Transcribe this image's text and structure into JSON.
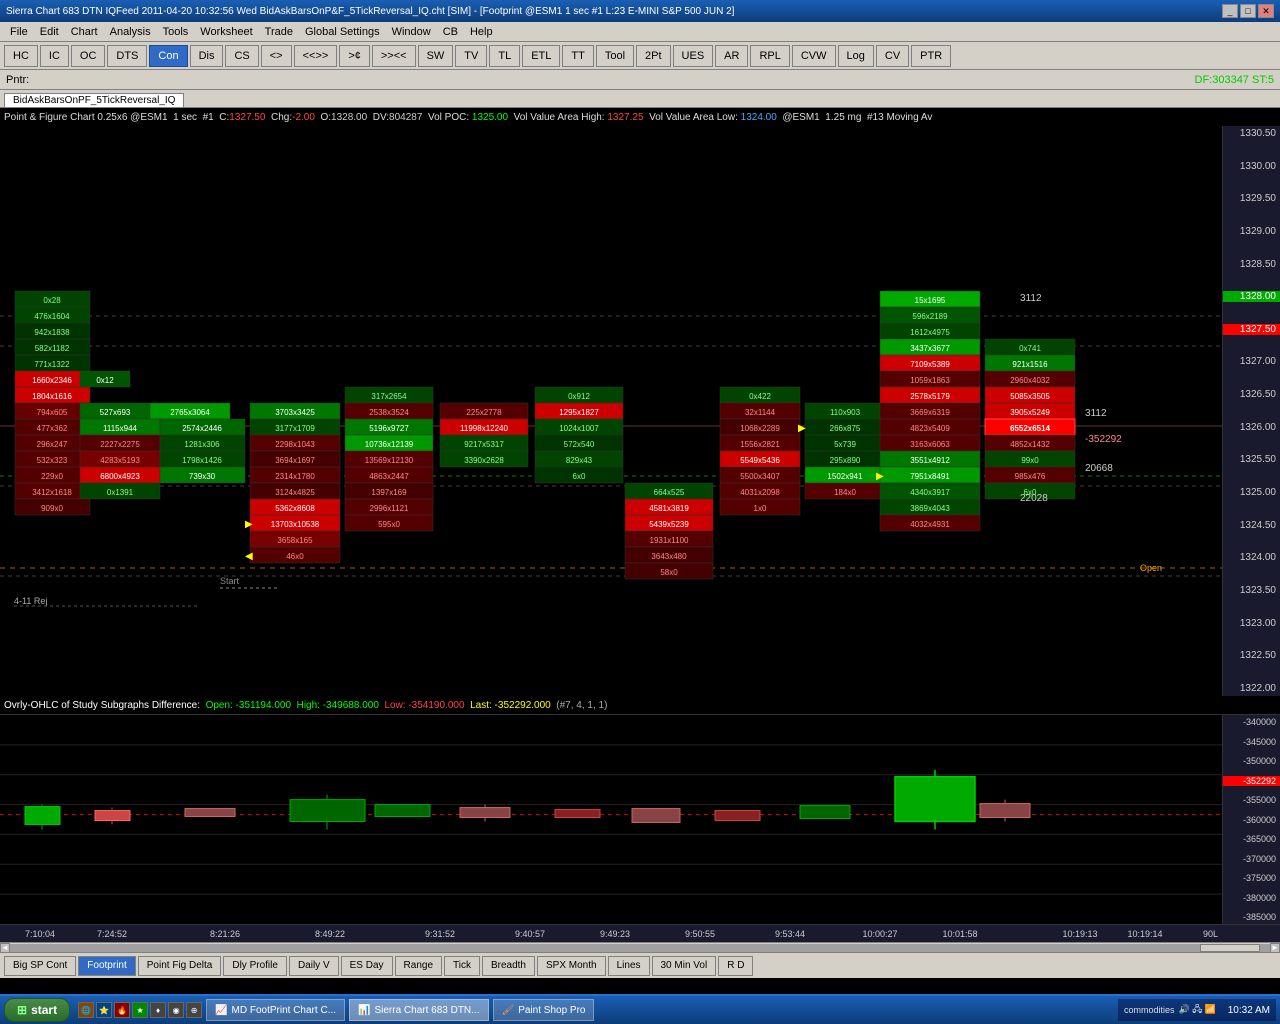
{
  "titleBar": {
    "title": "Sierra Chart 683 DTN IQFeed 2011-04-20  10:32:56  Wed  BidAskBarsOnP&F_5TickReversal_IQ.cht [SIM] - [Footprint @ESM1  1 sec  #1  L:23  E-MINI S&P 500 JUN 2]",
    "winButtons": [
      "_",
      "□",
      "✕"
    ]
  },
  "menuBar": {
    "items": [
      "File",
      "Edit",
      "Chart",
      "Analysis",
      "Tools",
      "Worksheet",
      "Trade",
      "Global Settings",
      "Window",
      "CB",
      "Help"
    ]
  },
  "toolbar": {
    "buttons": [
      "HC",
      "IC",
      "OC",
      "DTS",
      "Con",
      "Dis",
      "CS",
      "<>",
      "<<>>",
      ">¢",
      ">><<",
      "SW",
      "TV",
      "TL",
      "ETL",
      "TT",
      "Tool",
      "2Pt",
      "UES",
      "AR",
      "RPL",
      "CVW",
      "Log",
      "CV",
      "PTR"
    ],
    "activeBtn": "Con"
  },
  "statusBar": {
    "pntr": "Pntr:",
    "dfSt": "DF:303347  ST:5"
  },
  "chartTab": {
    "label": "BidAskBarsOnPF_5TickReversal_IQ"
  },
  "infoBar": {
    "text": "Point & Figure Chart 0.25x6 @ESM1  1 sec  #1  C:1327.50  Chg:-2.00  O:1328.00  DV:804287  Vol POC: 1325.00  Vol Value Area High: 1327.25  Vol Value Area Low: 1324.00  @ESM1  1.25 mg  #13 Moving Av"
  },
  "priceScale": {
    "labels": [
      "1330.50",
      "1330.00",
      "1329.50",
      "1329.00",
      "1328.50",
      "1328.00",
      "1327.50",
      "1327.00",
      "1326.50",
      "1326.00",
      "1325.50",
      "1325.00",
      "1324.50",
      "1324.00",
      "1323.50",
      "1323.00",
      "1322.50",
      "1322.00"
    ],
    "highlighted": "1327.50",
    "greenHighlighted": "1328.00"
  },
  "chartAnnotations": {
    "start": "Start",
    "open": "Open",
    "rej411": "4-11 Rej",
    "val3112a": "3112",
    "val3112b": "3112",
    "valNeg352292": "-352292",
    "val20668": "20668",
    "val22028": "22028"
  },
  "subInfoBar": {
    "text": "Ovrly-OHLC of Study Subgraphs Difference:  Open: -351194.000  High: -349688.000  Low: -354190.000  Last: -352292.000  (#7, 4, 1, 1)",
    "openColor": "#00ff00",
    "highColor": "#00ff00",
    "lowColor": "#ff4444",
    "lastColor": "#ffff00"
  },
  "subPriceScale": {
    "labels": [
      "-340000",
      "-345000",
      "-350000",
      "-355000",
      "-360000",
      "-365000",
      "-370000",
      "-375000",
      "-380000",
      "-385000"
    ],
    "highlighted": "-352292"
  },
  "timeAxis": {
    "labels": [
      "7:10:04",
      "7:24:52",
      "8:21:26",
      "8:49:22",
      "9:31:52",
      "9:40:57",
      "9:49:23",
      "9:50:55",
      "9:53:44",
      "10:00:27",
      "10:01:58",
      "10:19:13",
      "10:19:14"
    ],
    "scrollNote": "90L"
  },
  "bottomTabs": {
    "tabs": [
      "Big SP Cont",
      "Footprint",
      "Point Fig Delta",
      "Dly Profile",
      "Daily V",
      "ES Day",
      "Range",
      "Tick",
      "Breadth",
      "SPX Month",
      "Lines",
      "30 Min Vol",
      "R D"
    ],
    "activeTab": "Footprint"
  },
  "taskbar": {
    "startLabel": "start",
    "items": [
      "MD FootPrint Chart C...",
      "Sierra Chart 683 DTN...",
      "Paint Shop Pro"
    ],
    "time": "10:32 AM",
    "commodities": "commodities"
  },
  "footprintCells": [
    {
      "col": 0,
      "row": 0,
      "text": "0x28",
      "type": "dark-green"
    },
    {
      "col": 0,
      "row": 1,
      "text": "476x1604",
      "type": "dark-green"
    },
    {
      "col": 0,
      "row": 2,
      "text": "942x1838",
      "type": "dark-green"
    },
    {
      "col": 0,
      "row": 3,
      "text": "582x1182",
      "type": "dark-green"
    },
    {
      "col": 0,
      "row": 4,
      "text": "771x1322",
      "type": "dark-green"
    },
    {
      "col": 0,
      "row": 5,
      "text": "1660x2346",
      "type": "bright-red"
    },
    {
      "col": 0,
      "row": 6,
      "text": "1804x1616",
      "type": "bright-red"
    },
    {
      "col": 0,
      "row": 7,
      "text": "794x605",
      "type": "dark-red"
    },
    {
      "col": 0,
      "row": 8,
      "text": "477x362",
      "type": "dark-red"
    },
    {
      "col": 0,
      "row": 9,
      "text": "296x247",
      "type": "dark-red"
    },
    {
      "col": 0,
      "row": 10,
      "text": "532x323",
      "type": "dark-red"
    },
    {
      "col": 0,
      "row": 11,
      "text": "229x0",
      "type": "dark-red"
    },
    {
      "col": 0,
      "row": 12,
      "text": "3412x1618",
      "type": "dark-red"
    },
    {
      "col": 0,
      "row": 13,
      "text": "909x0",
      "type": "dark-red"
    }
  ],
  "colors": {
    "background": "#000000",
    "chartBg": "#000000",
    "greenCell": "#006400",
    "redCell": "#8b0000",
    "brightGreen": "#00aa00",
    "brightRed": "#cc0000",
    "highlightRed": "#ff2222",
    "highlightGreen": "#22ff22",
    "priceScale": "#1a1a2e",
    "accentBlue": "#316ac5"
  }
}
